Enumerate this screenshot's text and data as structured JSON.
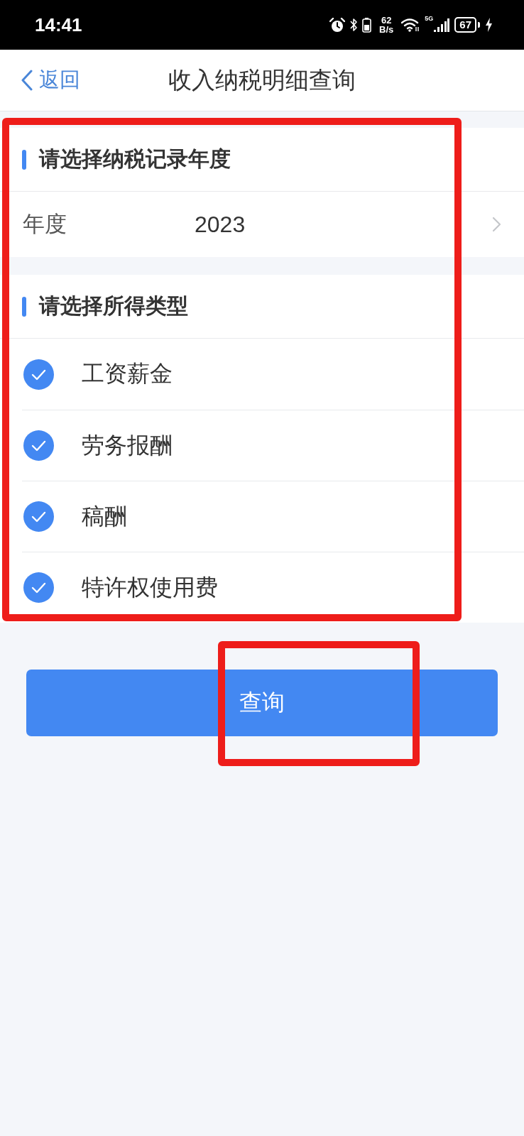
{
  "status_bar": {
    "time": "14:41",
    "net_speed_value": "62",
    "net_speed_unit": "B/s",
    "network_type": "5G",
    "battery": "67",
    "charging": true
  },
  "nav_bar": {
    "back_label": "返回",
    "title": "收入纳税明细查询"
  },
  "form": {
    "highlighted": true,
    "year_section": {
      "title": "请选择纳税记录年度",
      "field": {
        "label": "年度",
        "value": "2023"
      }
    },
    "income_section": {
      "title": "请选择所得类型",
      "options": [
        {
          "label": "工资薪金",
          "checked": true
        },
        {
          "label": "劳务报酬",
          "checked": true
        },
        {
          "label": "稿酬",
          "checked": true
        },
        {
          "label": "特许权使用费",
          "checked": true
        }
      ]
    }
  },
  "query_button": {
    "label": "查询",
    "highlighted": true
  }
}
